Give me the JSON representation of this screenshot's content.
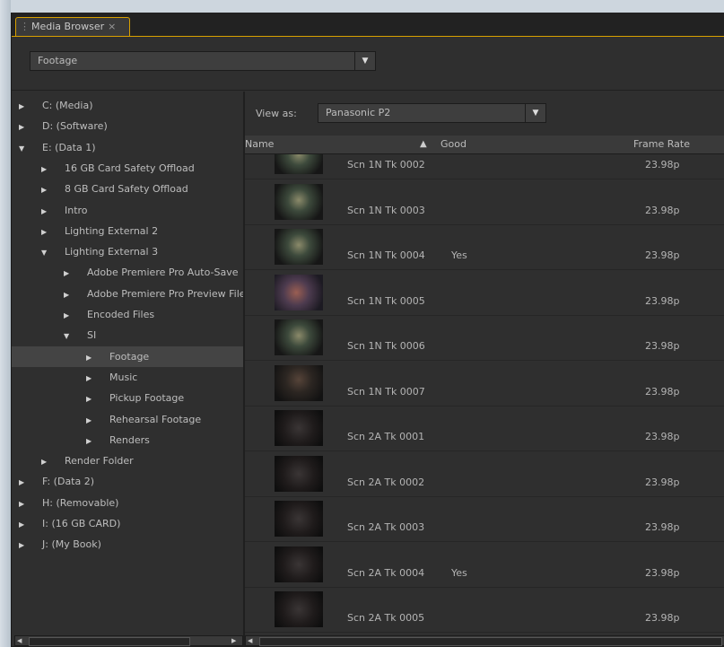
{
  "panel": {
    "tab_title": "Media Browser",
    "tab_close": "×",
    "source_select": "Footage"
  },
  "tree": [
    {
      "label": "C: (Media)",
      "twisty": "▶",
      "indent": 0
    },
    {
      "label": "D: (Software)",
      "twisty": "▶",
      "indent": 0
    },
    {
      "label": "E: (Data 1)",
      "twisty": "▼",
      "indent": 0
    },
    {
      "label": "16 GB Card Safety Offload",
      "twisty": "▶",
      "indent": 1
    },
    {
      "label": "8 GB Card Safety Offload",
      "twisty": "▶",
      "indent": 1
    },
    {
      "label": "Intro",
      "twisty": "▶",
      "indent": 1
    },
    {
      "label": "Lighting External 2",
      "twisty": "▶",
      "indent": 1
    },
    {
      "label": "Lighting External 3",
      "twisty": "▼",
      "indent": 1
    },
    {
      "label": "Adobe Premiere Pro Auto-Save",
      "twisty": "▶",
      "indent": 2
    },
    {
      "label": "Adobe Premiere Pro Preview Files",
      "twisty": "▶",
      "indent": 2
    },
    {
      "label": "Encoded Files",
      "twisty": "▶",
      "indent": 2
    },
    {
      "label": "SI",
      "twisty": "▼",
      "indent": 2
    },
    {
      "label": "Footage",
      "twisty": "▶",
      "indent": 3,
      "selected": true
    },
    {
      "label": "Music",
      "twisty": "▶",
      "indent": 3
    },
    {
      "label": "Pickup Footage",
      "twisty": "▶",
      "indent": 3
    },
    {
      "label": "Rehearsal Footage",
      "twisty": "▶",
      "indent": 3
    },
    {
      "label": "Renders",
      "twisty": "▶",
      "indent": 3
    },
    {
      "label": "Render Folder",
      "twisty": "▶",
      "indent": 1
    },
    {
      "label": "F: (Data 2)",
      "twisty": "▶",
      "indent": 0
    },
    {
      "label": "H: (Removable)",
      "twisty": "▶",
      "indent": 0
    },
    {
      "label": "I: (16 GB CARD)",
      "twisty": "▶",
      "indent": 0
    },
    {
      "label": "J: (My Book)",
      "twisty": "▶",
      "indent": 0
    }
  ],
  "view_as": {
    "label": "View as:",
    "value": "Panasonic P2"
  },
  "columns": {
    "name": "Name",
    "sort_icon": "▲",
    "good": "Good",
    "frame_rate": "Frame Rate"
  },
  "clips": [
    {
      "name": "Scn 1N Tk 0002",
      "good": "",
      "frame_rate": "23.98p",
      "thumb": "t1"
    },
    {
      "name": "Scn 1N Tk 0003",
      "good": "",
      "frame_rate": "23.98p",
      "thumb": "t1"
    },
    {
      "name": "Scn 1N Tk 0004",
      "good": "Yes",
      "frame_rate": "23.98p",
      "thumb": "t1"
    },
    {
      "name": "Scn 1N Tk 0005",
      "good": "",
      "frame_rate": "23.98p",
      "thumb": "t2"
    },
    {
      "name": "Scn 1N Tk 0006",
      "good": "",
      "frame_rate": "23.98p",
      "thumb": "t1"
    },
    {
      "name": "Scn 1N Tk 0007",
      "good": "",
      "frame_rate": "23.98p",
      "thumb": "t3"
    },
    {
      "name": "Scn 2A Tk 0001",
      "good": "",
      "frame_rate": "23.98p",
      "thumb": "t4"
    },
    {
      "name": "Scn 2A Tk 0002",
      "good": "",
      "frame_rate": "23.98p",
      "thumb": "t4"
    },
    {
      "name": "Scn 2A Tk 0003",
      "good": "",
      "frame_rate": "23.98p",
      "thumb": "t4"
    },
    {
      "name": "Scn 2A Tk 0004",
      "good": "Yes",
      "frame_rate": "23.98p",
      "thumb": "t4"
    },
    {
      "name": "Scn 2A Tk 0005",
      "good": "",
      "frame_rate": "23.98p",
      "thumb": "t4"
    }
  ],
  "colors": {
    "accent": "#d8a000",
    "panel_bg": "#2f2f2f"
  }
}
